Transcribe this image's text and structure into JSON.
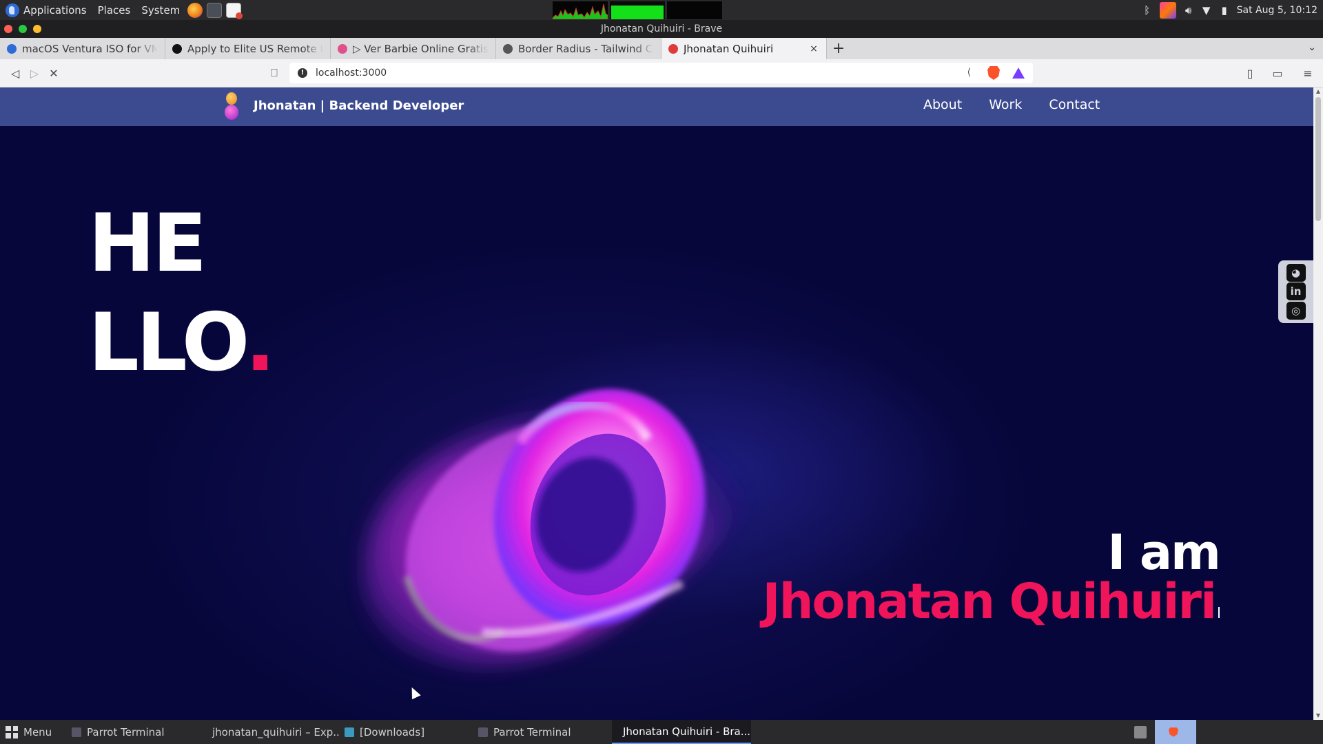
{
  "system_panel": {
    "menus": [
      "Applications",
      "Places",
      "System"
    ],
    "datetime": "Sat Aug 5, 10:12"
  },
  "window": {
    "title": "Jhonatan Quihuiri - Brave"
  },
  "tabs": [
    {
      "label": "macOS Ventura ISO for VM by",
      "favicon_color": "#2f6bd6",
      "active": false
    },
    {
      "label": "Apply to Elite US Remote Deve",
      "favicon_color": "#111111",
      "active": false
    },
    {
      "label": "▷ Ver Barbie Online Gratis en",
      "favicon_color": "#e0508a",
      "active": false
    },
    {
      "label": "Border Radius - Tailwind CSS",
      "favicon_color": "#555555",
      "active": false
    },
    {
      "label": "Jhonatan Quihuiri",
      "favicon_color": "#e03a3a",
      "active": true
    }
  ],
  "tab_controls": {
    "close": "×",
    "new_tab": "+",
    "tab_menu": "⌄"
  },
  "address_bar": {
    "url": "localhost:3000",
    "info_icon": "!"
  },
  "site": {
    "brand": "Jhonatan  | Backend Developer",
    "nav": [
      "About",
      "Work",
      "Contact"
    ],
    "hello_line1": "HE",
    "hello_line2": "LLO",
    "hello_dot": ".",
    "intro_line1": "I am",
    "intro_line2": "Jhonatan Quihuiri",
    "social": [
      "github-icon",
      "linkedin-icon",
      "instagram-icon"
    ],
    "accent_color": "#f0145a",
    "nav_bg": "#3c4a8f",
    "page_bg": "#06063a"
  },
  "taskbar": {
    "menu_label": "Menu",
    "tasks": [
      "Parrot Terminal",
      "jhonatan_quihuiri – Exp...",
      "[Downloads]",
      "Parrot Terminal",
      "Jhonatan Quihuiri - Bra..."
    ]
  }
}
